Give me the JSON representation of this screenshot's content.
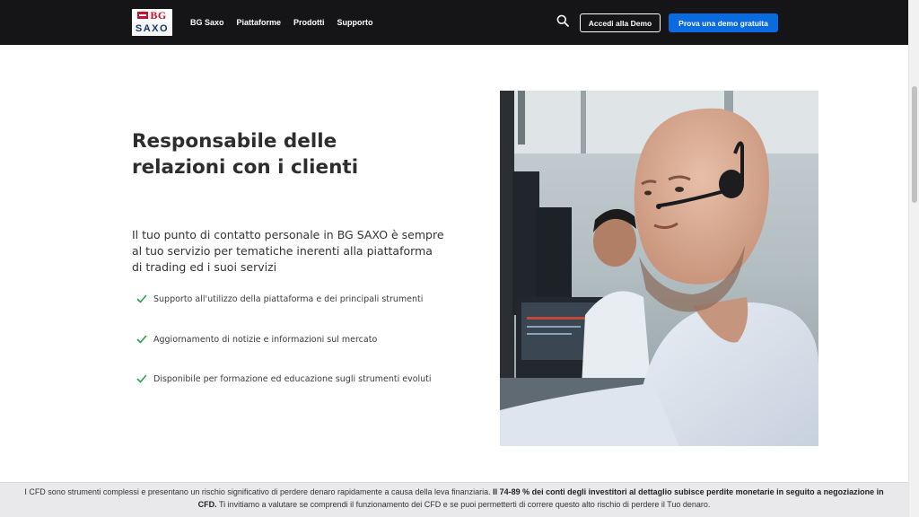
{
  "header": {
    "logo_top": "BG",
    "logo_bottom": "SAXO",
    "nav": [
      "BG Saxo",
      "Piattaforme",
      "Prodotti",
      "Supporto"
    ],
    "search_icon": "search-icon",
    "login_button": "Accedi alla Demo",
    "cta_button": "Prova una demo gratuita",
    "colors": {
      "header_bg": "#151518",
      "primary": "#0a6be0"
    }
  },
  "main": {
    "title": "Responsabile delle relazioni con i clienti",
    "intro": "Il tuo punto di contatto personale in BG SAXO è sempre al tuo servizio per tematiche inerenti alla piattaforma di trading ed i suoi servizi",
    "features": [
      "Supporto all'utilizzo della piattaforma e dei principali strumenti",
      "Aggiornamento di notizie e informazioni sul mercato",
      "Disponibile per formazione ed educazione sugli strumenti evoluti"
    ],
    "check_color": "#2e9e4f"
  },
  "disclaimer": {
    "part1": "I CFD sono strumenti complessi e presentano un rischio significativo di perdere denaro rapidamente a causa della leva finanziaria. ",
    "bold": "Il 74-89 % dei conti degli investitori al dettaglio subisce perdite monetarie in seguito a negoziazione in CFD.",
    "part2": " Ti invitiamo a valutare se comprendi il funzionamento dei CFD e se puoi permetterti di correre questo alto rischio di perdere il Tuo denaro."
  }
}
